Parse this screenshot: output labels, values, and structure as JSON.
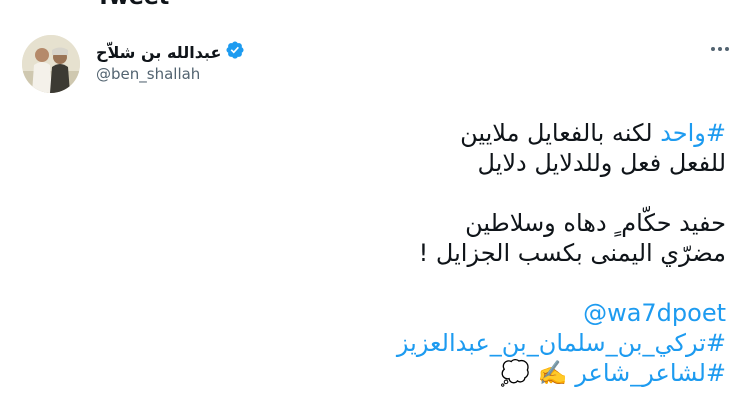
{
  "header": {
    "title": "Tweet"
  },
  "author": {
    "display_name": "عبدالله بن شلاّح",
    "handle": "@ben_shallah",
    "verified": true
  },
  "tweet": {
    "line1_hashtag": "#واحد",
    "line1_text": " لكنه بالفعايل ملايين",
    "line2": "للفعل فعل وللدلايل دلايل",
    "line3": "حفيد حكّام ٍ دهاه وسلاطين",
    "line4": "مضرّي اليمنى بكسب الجزايل !",
    "mention": "@wa7dpoet",
    "hashtag2": "#تركي_بن_سلمان_بن_عبدالعزيز",
    "hashtag3": "#لشاعر_شاعر",
    "emoji3": " ✍️ 💭"
  },
  "colors": {
    "link": "#1d9bf0",
    "text": "#0f1419",
    "secondary": "#536471"
  },
  "icons": {
    "verified": "verified-badge-icon",
    "more": "more-options-icon"
  }
}
